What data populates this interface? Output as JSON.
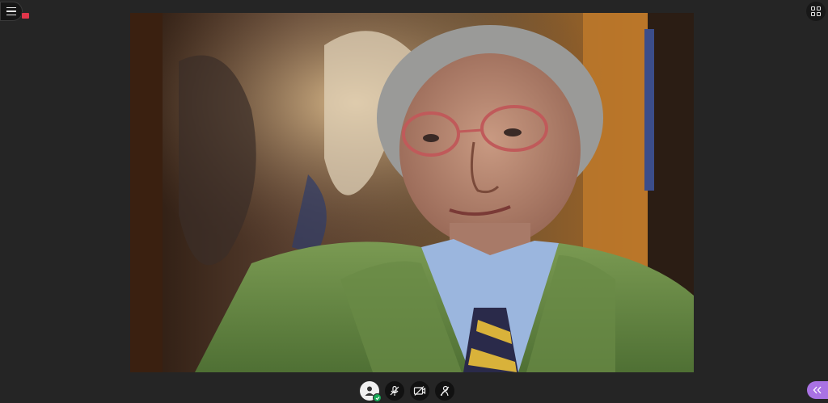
{
  "colors": {
    "background": "#252525",
    "record_indicator": "#e0354a",
    "status_ok": "#18a957",
    "expand_tab": "#a972e3"
  },
  "top_bar": {
    "menu_icon": "hamburger-menu-icon",
    "recording_icon": "recording-indicator-icon",
    "layout_icon": "grid-layout-icon"
  },
  "video": {
    "type": "webcam-feed"
  },
  "controls": [
    {
      "name": "join-audio-button",
      "icon": "user-audio-icon",
      "status": "connected"
    },
    {
      "name": "mute-button",
      "icon": "microphone-muted-icon"
    },
    {
      "name": "camera-button",
      "icon": "camera-off-icon"
    },
    {
      "name": "raise-hand-button",
      "icon": "hand-raise-icon"
    }
  ],
  "side_panel": {
    "icon": "double-chevron-left-icon"
  }
}
